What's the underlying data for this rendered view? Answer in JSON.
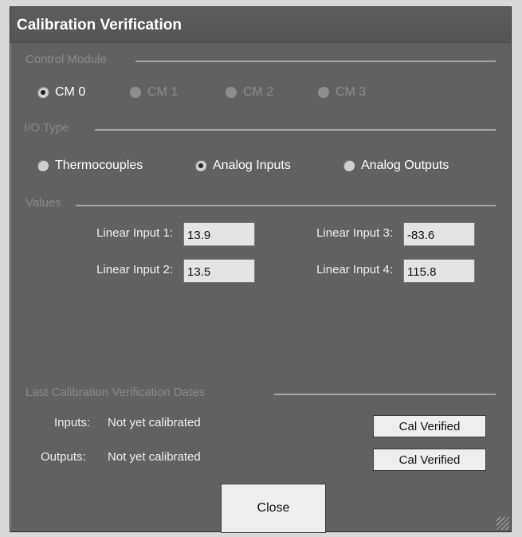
{
  "window": {
    "title": "Calibration Verification"
  },
  "control_module": {
    "label": "Control Module",
    "options": [
      {
        "label": "CM 0",
        "checked": true,
        "enabled": true
      },
      {
        "label": "CM 1",
        "checked": false,
        "enabled": false
      },
      {
        "label": "CM 2",
        "checked": false,
        "enabled": false
      },
      {
        "label": "CM 3",
        "checked": false,
        "enabled": false
      }
    ]
  },
  "io_type": {
    "label": "I/O Type",
    "options": [
      {
        "label": "Thermocouples",
        "checked": false
      },
      {
        "label": "Analog Inputs",
        "checked": true
      },
      {
        "label": "Analog Outputs",
        "checked": false
      }
    ]
  },
  "values": {
    "label": "Values",
    "fields": [
      {
        "label": "Linear Input 1:",
        "value": "13.9"
      },
      {
        "label": "Linear Input 2:",
        "value": "13.5"
      },
      {
        "label": "Linear Input 3:",
        "value": "-83.6"
      },
      {
        "label": "Linear Input 4:",
        "value": "115.8"
      }
    ]
  },
  "last_cal": {
    "label": "Last Calibration Verification Dates",
    "inputs_label": "Inputs:",
    "inputs_value": "Not yet calibrated",
    "outputs_label": "Outputs:",
    "outputs_value": "Not yet calibrated",
    "cal_verified_label": "Cal Verified"
  },
  "close_label": "Close",
  "colors": {
    "window_bg": "#616161",
    "title_text": "#ffffff",
    "group_label": "#8a8a8a",
    "button_bg": "#eeeeee",
    "field_bg": "#e4e4e4"
  }
}
